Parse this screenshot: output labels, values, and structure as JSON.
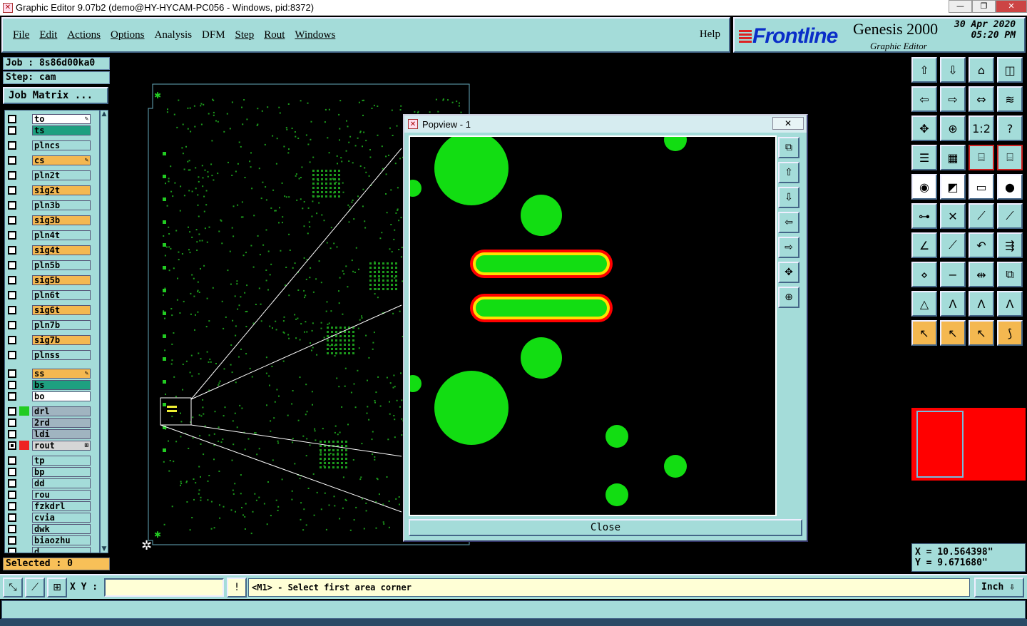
{
  "window": {
    "title": "Graphic Editor 9.07b2 (demo@HY-HYCAM-PC056 - Windows, pid:8372)"
  },
  "menu": [
    {
      "label": "File",
      "u": true
    },
    {
      "label": "Edit",
      "u": true
    },
    {
      "label": "Actions",
      "u": true
    },
    {
      "label": "Options",
      "u": true
    },
    {
      "label": "Analysis",
      "u": false
    },
    {
      "label": "DFM",
      "u": false
    },
    {
      "label": "Step",
      "u": true
    },
    {
      "label": "Rout",
      "u": true
    },
    {
      "label": "Windows",
      "u": true
    }
  ],
  "help_label": "Help",
  "brand": {
    "logo": "Frontline",
    "product": "Genesis 2000",
    "subtitle": "Graphic Editor",
    "date": "30 Apr 2020",
    "time": "05:20 PM"
  },
  "job": {
    "job_label": "Job : 8s86d00ka0",
    "step_label": "Step: cam",
    "matrix_button": "Job Matrix ..."
  },
  "layers": [
    {
      "name": "to",
      "color": "#ffffff",
      "marker": "✎",
      "group": 0
    },
    {
      "name": "ts",
      "color": "#1ea080",
      "marker": "",
      "group": 0
    },
    {
      "name": "plncs",
      "color": "#a4dcd9",
      "marker": "",
      "group": 1
    },
    {
      "name": "cs",
      "color": "#f4b850",
      "marker": "✎",
      "group": 1
    },
    {
      "name": "pln2t",
      "color": "#a4dcd9",
      "marker": "",
      "group": 1
    },
    {
      "name": "sig2t",
      "color": "#f4b850",
      "marker": "",
      "group": 1
    },
    {
      "name": "pln3b",
      "color": "#a4dcd9",
      "marker": "",
      "group": 1
    },
    {
      "name": "sig3b",
      "color": "#f4b850",
      "marker": "",
      "group": 1
    },
    {
      "name": "pln4t",
      "color": "#a4dcd9",
      "marker": "",
      "group": 1
    },
    {
      "name": "sig4t",
      "color": "#f4b850",
      "marker": "",
      "group": 1
    },
    {
      "name": "pln5b",
      "color": "#a4dcd9",
      "marker": "",
      "group": 1
    },
    {
      "name": "sig5b",
      "color": "#f4b850",
      "marker": "",
      "group": 1
    },
    {
      "name": "pln6t",
      "color": "#a4dcd9",
      "marker": "",
      "group": 1
    },
    {
      "name": "sig6t",
      "color": "#f4b850",
      "marker": "",
      "group": 1
    },
    {
      "name": "pln7b",
      "color": "#a4dcd9",
      "marker": "",
      "group": 1
    },
    {
      "name": "sig7b",
      "color": "#f4b850",
      "marker": "",
      "group": 1
    },
    {
      "name": "plnss",
      "color": "#a4dcd9",
      "marker": "",
      "group": 1
    },
    {
      "name": "ss",
      "color": "#f4b850",
      "marker": "✎",
      "group": 2
    },
    {
      "name": "bs",
      "color": "#1ea080",
      "marker": "",
      "group": 2
    },
    {
      "name": "bo",
      "color": "#ffffff",
      "marker": "",
      "group": 2
    },
    {
      "name": "drl",
      "color": "#a0b4c0",
      "marker": "",
      "group": 3,
      "swatch": "#22cc22"
    },
    {
      "name": "2rd",
      "color": "#a0b4c0",
      "marker": "",
      "group": 3
    },
    {
      "name": "ldi",
      "color": "#a0b4c0",
      "marker": "",
      "group": 3
    },
    {
      "name": "rout",
      "color": "#d6d6d6",
      "marker": "⊞",
      "group": 3,
      "swatch": "#ee2222",
      "checked": true
    },
    {
      "name": "tp",
      "color": "#a4dcd9",
      "marker": "",
      "group": 4
    },
    {
      "name": "bp",
      "color": "#a4dcd9",
      "marker": "",
      "group": 4
    },
    {
      "name": "dd",
      "color": "#a4dcd9",
      "marker": "",
      "group": 4
    },
    {
      "name": "rou",
      "color": "#a4dcd9",
      "marker": "",
      "group": 4
    },
    {
      "name": "fzkdrl",
      "color": "#a4dcd9",
      "marker": "",
      "group": 4
    },
    {
      "name": "cvia",
      "color": "#a4dcd9",
      "marker": "",
      "group": 4
    },
    {
      "name": "dwk",
      "color": "#a4dcd9",
      "marker": "",
      "group": 4
    },
    {
      "name": "biaozhu",
      "color": "#a4dcd9",
      "marker": "",
      "group": 4
    },
    {
      "name": "d",
      "color": "#a4dcd9",
      "marker": "",
      "group": 4
    }
  ],
  "selected_label": "Selected : 0",
  "popview": {
    "title": "Popview - 1",
    "close_button": "Close"
  },
  "coords": {
    "x": "X = 10.564398\"",
    "y": "Y = 9.671680\""
  },
  "bottom": {
    "xy_label": "X Y :",
    "xy_value": "",
    "prompt": "<M1> - Select first area corner",
    "units": "Inch"
  },
  "colors": {
    "panel": "#a4dcd9",
    "pcb_green": "#22cc22",
    "red": "#ff0000",
    "yellow": "#ffe000"
  }
}
